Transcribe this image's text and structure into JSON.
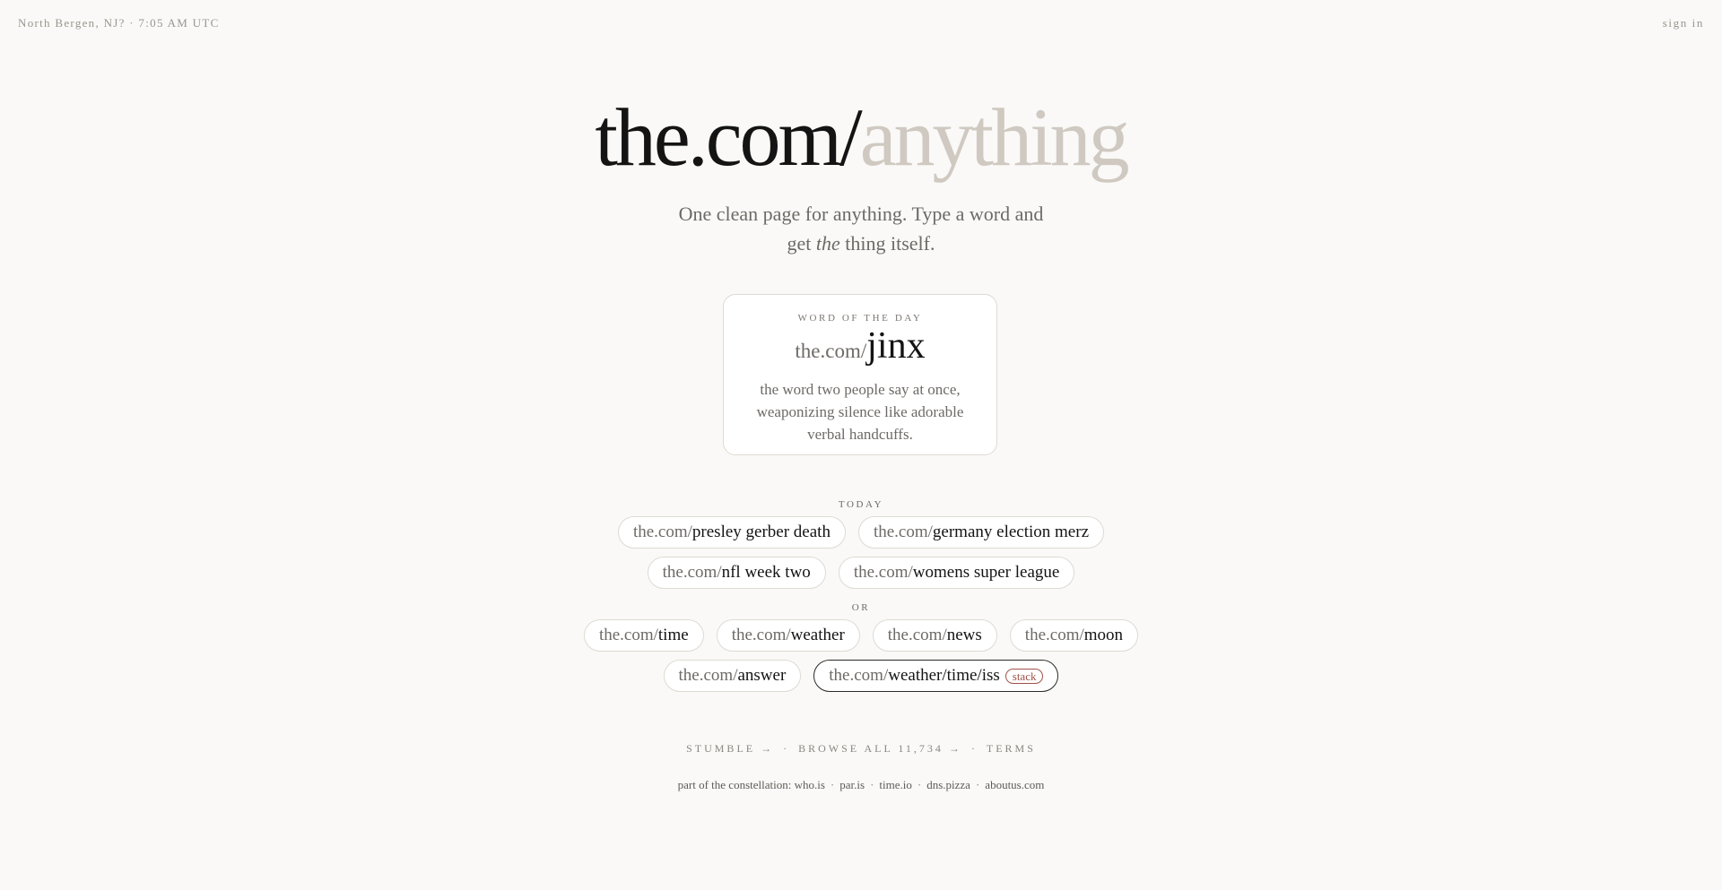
{
  "header": {
    "location": "North Bergen, NJ? · 7:05 AM UTC",
    "sign_in": "sign in"
  },
  "hero": {
    "prefix": "the.com/",
    "suffix": "anything"
  },
  "tagline": {
    "line1": "One clean page for anything. Type a word and",
    "line2_before": "get ",
    "line2_em": "the",
    "line2_after": " thing itself."
  },
  "word_of_day": {
    "label": "WORD OF THE DAY",
    "prefix": "the.com/",
    "word": "jinx",
    "definition": "the word two people say at once, weaponizing silence like adorable verbal handcuffs."
  },
  "today": {
    "label": "TODAY",
    "items": [
      {
        "prefix": "the.com/",
        "slug": "presley gerber death"
      },
      {
        "prefix": "the.com/",
        "slug": "germany election merz"
      },
      {
        "prefix": "the.com/",
        "slug": "nfl week two"
      },
      {
        "prefix": "the.com/",
        "slug": "womens super league"
      }
    ]
  },
  "or": {
    "label": "OR",
    "items": [
      {
        "prefix": "the.com/",
        "slug": "time"
      },
      {
        "prefix": "the.com/",
        "slug": "weather"
      },
      {
        "prefix": "the.com/",
        "slug": "news"
      },
      {
        "prefix": "the.com/",
        "slug": "moon"
      },
      {
        "prefix": "the.com/",
        "slug": "answer"
      },
      {
        "prefix": "the.com/",
        "slug": "weather/time/iss",
        "badge": "stack"
      }
    ]
  },
  "footer": {
    "stumble": "STUMBLE →",
    "browse": "BROWSE ALL 11,734 →",
    "terms": "TERMS",
    "separator": "·",
    "constellation_label": "part of the constellation:",
    "constellation_links": [
      "who.is",
      "par.is",
      "time.io",
      "dns.pizza",
      "aboutus.com"
    ]
  },
  "colors": {
    "background": "#faf9f7",
    "hero_suffix": "#cfc9c1",
    "badge": "#a0524a"
  }
}
